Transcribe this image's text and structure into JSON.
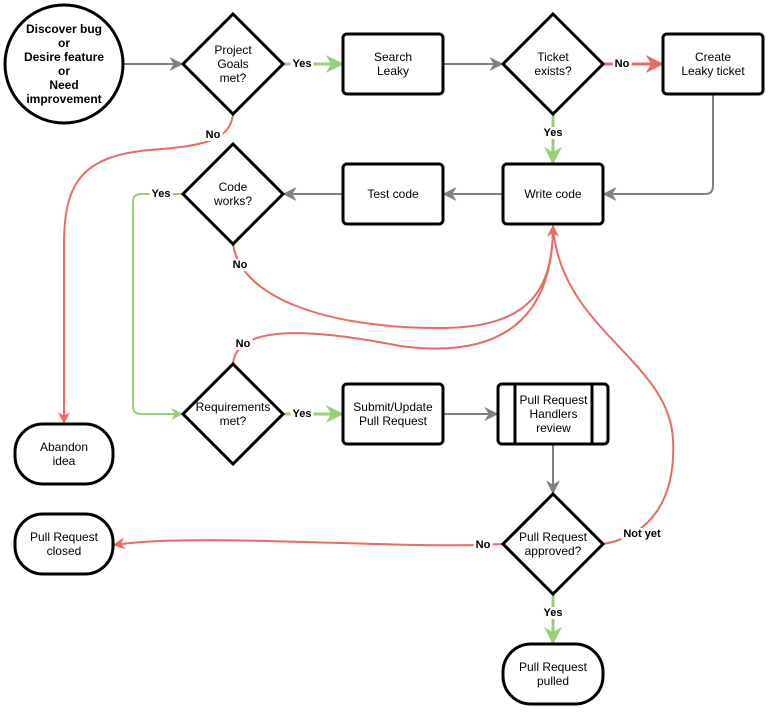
{
  "colors": {
    "no": "#EA6B66",
    "yes": "#97D077",
    "flow": "#808080",
    "stroke": "#000000"
  },
  "nodes": {
    "start": "Discover bug\nor\nDesire feature\nor\nNeed\nimprovement",
    "project_goals": "Project\nGoals\nmet?",
    "search_leaky": "Search\nLeaky",
    "ticket_exists": "Ticket\nexists?",
    "create_ticket": "Create\nLeaky ticket",
    "write_code": "Write code",
    "test_code": "Test code",
    "code_works": "Code\nworks?",
    "requirements_met": "Requirements\nmet?",
    "submit_pr": "Submit/Update\nPull Request",
    "handlers_review": "Pull Request\nHandlers\nreview",
    "pr_approved": "Pull Request\napproved?",
    "abandon": "Abandon\nidea",
    "pr_closed": "Pull Request\nclosed",
    "pr_pulled": "Pull Request\npulled"
  },
  "edge_labels": {
    "goals_yes": "Yes",
    "goals_no": "No",
    "ticket_no": "No",
    "ticket_yes": "Yes",
    "works_yes": "Yes",
    "works_no": "No",
    "req_yes": "Yes",
    "req_no": "No",
    "approved_no": "No",
    "approved_not_yet": "Not yet",
    "approved_yes": "Yes"
  }
}
